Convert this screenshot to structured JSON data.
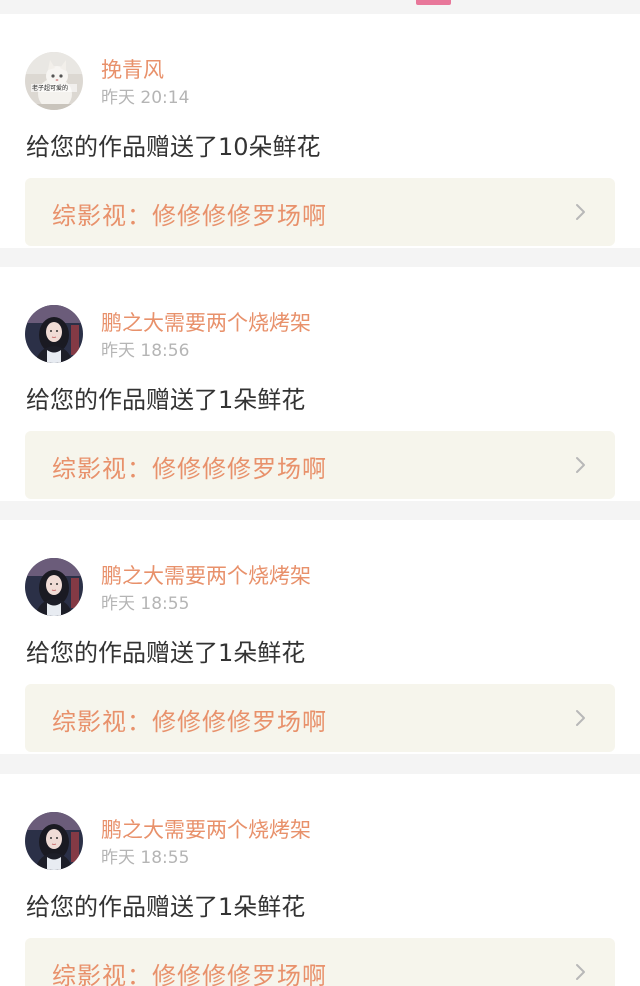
{
  "accent_color": "#e8779a",
  "name_color": "#e8916b",
  "notifications": [
    {
      "username": "挽青风",
      "time": "昨天 20:14",
      "message": "给您的作品赠送了10朵鲜花",
      "work_title": "综影视：修修修修罗场啊",
      "avatar_caption": "老子超可爱的",
      "avatar_icon": "cat-photo-avatar"
    },
    {
      "username": "鹏之大需要两个烧烤架",
      "time": "昨天 18:56",
      "message": "给您的作品赠送了1朵鲜花",
      "work_title": "综影视：修修修修罗场啊",
      "avatar_icon": "girl-portrait-avatar"
    },
    {
      "username": "鹏之大需要两个烧烤架",
      "time": "昨天 18:55",
      "message": "给您的作品赠送了1朵鲜花",
      "work_title": "综影视：修修修修罗场啊",
      "avatar_icon": "girl-portrait-avatar"
    },
    {
      "username": "鹏之大需要两个烧烤架",
      "time": "昨天 18:55",
      "message": "给您的作品赠送了1朵鲜花",
      "work_title": "综影视：修修修修罗场啊",
      "avatar_icon": "girl-portrait-avatar"
    }
  ]
}
